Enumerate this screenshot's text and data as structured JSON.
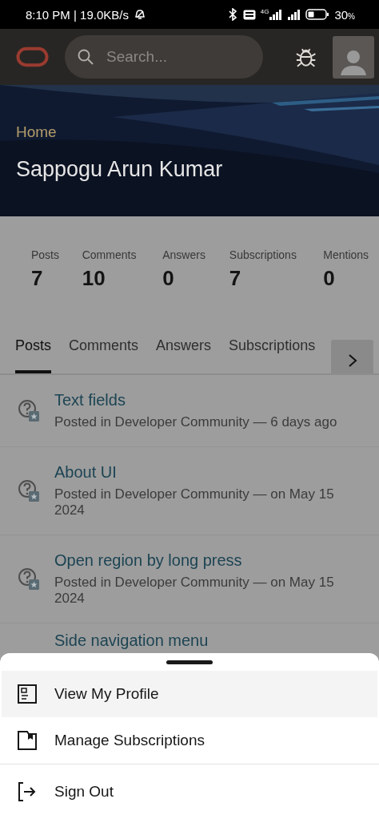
{
  "status_bar": {
    "time": "8:10 PM | 19.0KB/s",
    "network": "4G",
    "battery": "30",
    "battery_unit": "%"
  },
  "header": {
    "search": {
      "placeholder": "Search..."
    }
  },
  "hero": {
    "breadcrumb": "Home",
    "name": "Sappogu Arun Kumar"
  },
  "stats": [
    {
      "label": "Posts",
      "value": "7"
    },
    {
      "label": "Comments",
      "value": "10"
    },
    {
      "label": "Answers",
      "value": "0"
    },
    {
      "label": "Subscriptions",
      "value": "7"
    },
    {
      "label": "Mentions",
      "value": "0"
    }
  ],
  "tabs": [
    {
      "label": "Posts",
      "selected": true
    },
    {
      "label": "Comments",
      "selected": false
    },
    {
      "label": "Answers",
      "selected": false
    },
    {
      "label": "Subscriptions",
      "selected": false
    }
  ],
  "posts": [
    {
      "title": "Text fields",
      "meta": "Posted in Developer Community — 6 days ago"
    },
    {
      "title": "About UI",
      "meta": "Posted in Developer Community — on May 15 2024"
    },
    {
      "title": "Open region by long press",
      "meta": "Posted in Developer Community — on May 15 2024"
    },
    {
      "title": "Side navigation menu"
    }
  ],
  "menu_groups": [
    {
      "items": [
        {
          "label": "View My Profile",
          "selected": true
        },
        {
          "label": "Manage Subscriptions",
          "selected": false
        }
      ]
    },
    {
      "items": [
        {
          "label": "Sign Out",
          "selected": false
        }
      ]
    }
  ]
}
